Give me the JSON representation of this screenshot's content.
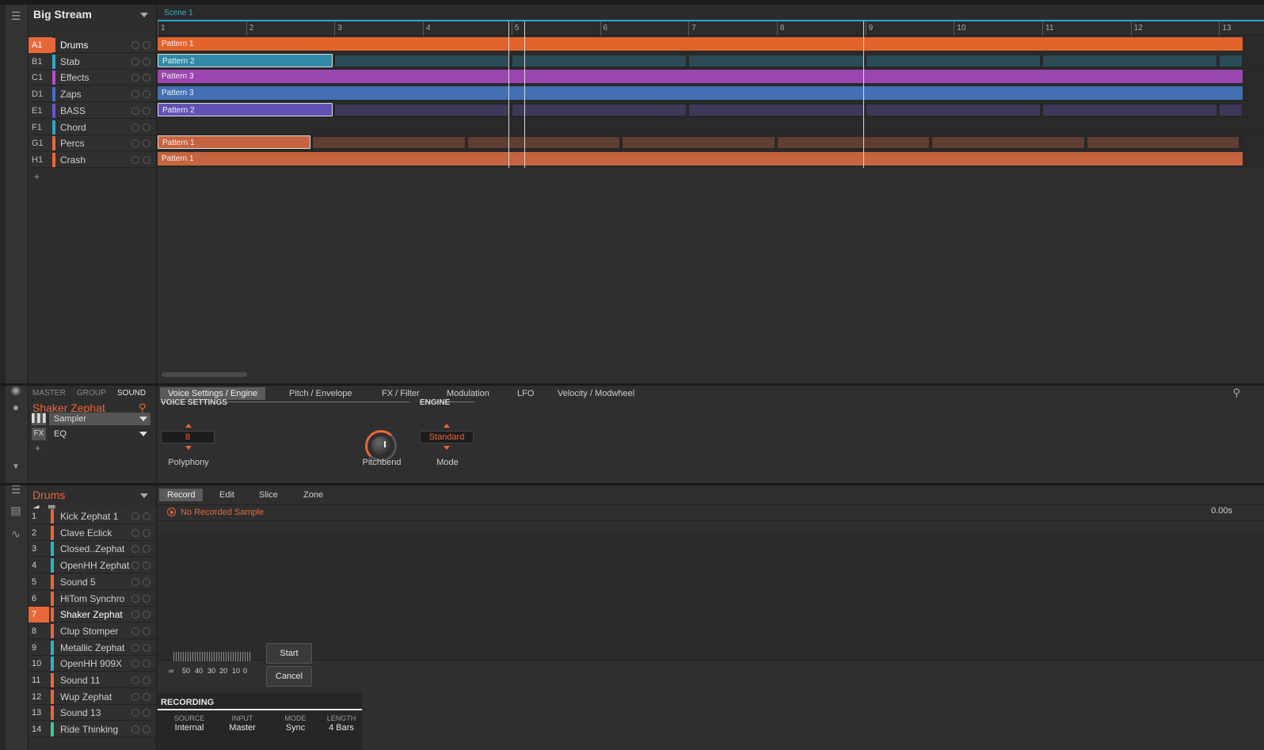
{
  "project": {
    "title": "Big Stream"
  },
  "scene": {
    "label": "Scene 1"
  },
  "ruler": [
    "1",
    "2",
    "3",
    "4",
    "5",
    "6",
    "7",
    "8",
    "9",
    "10",
    "11",
    "12",
    "13"
  ],
  "groups": [
    {
      "slot": "A1",
      "name": "Drums",
      "color": "#e8683a",
      "selected": true
    },
    {
      "slot": "B1",
      "name": "Stab",
      "color": "#2aa7c9"
    },
    {
      "slot": "C1",
      "name": "Effects",
      "color": "#b04fc4"
    },
    {
      "slot": "D1",
      "name": "Zaps",
      "color": "#3f73c9"
    },
    {
      "slot": "E1",
      "name": "BASS",
      "color": "#6b56c9"
    },
    {
      "slot": "F1",
      "name": "Chord",
      "color": "#2aa7c9"
    },
    {
      "slot": "G1",
      "name": "Percs",
      "color": "#e8683a"
    },
    {
      "slot": "H1",
      "name": "Crash",
      "color": "#e8683a"
    }
  ],
  "clips": [
    {
      "label": "Pattern 1",
      "color": "#e2642d"
    },
    {
      "label": "Pattern 2",
      "color": "#2f8aa8"
    },
    {
      "label": "Pattern 3",
      "color": "#9a45b0"
    },
    {
      "label": "Pattern 3",
      "color": "#4370b5"
    },
    {
      "label": "Pattern 2",
      "color": "#6352b5"
    },
    {
      "label": "",
      "color": ""
    },
    {
      "label": "Pattern 1",
      "color": "#c6643f"
    },
    {
      "label": "Pattern 1",
      "color": "#c6643f"
    }
  ],
  "control": {
    "tabs": [
      "MASTER",
      "GROUP",
      "SOUND"
    ],
    "sound_name": "Shaker Zephat",
    "plugins": [
      {
        "icon": "▌▌▌",
        "name": "Sampler"
      },
      {
        "icon": "FX",
        "name": "EQ"
      }
    ],
    "page_tabs": [
      "Voice Settings / Engine",
      "Pitch / Envelope",
      "FX / Filter",
      "Modulation",
      "LFO",
      "Velocity / Modwheel"
    ],
    "voice_settings_label": "VOICE SETTINGS",
    "engine_label": "ENGINE",
    "polyphony_value": "8",
    "polyphony_label": "Polyphony",
    "pitchbend_label": "Pitchbend",
    "mode_value": "Standard",
    "mode_label": "Mode"
  },
  "sounds_panel": {
    "group_name": "Drums",
    "sounds": [
      {
        "num": "1",
        "name": "Kick Zephat 1",
        "color": "#e8683a"
      },
      {
        "num": "2",
        "name": "Clave Eclick",
        "color": "#e8683a"
      },
      {
        "num": "3",
        "name": "Closed..Zephat",
        "color": "#2ab3c9"
      },
      {
        "num": "4",
        "name": "OpenHH Zephat",
        "color": "#2ab3c9"
      },
      {
        "num": "5",
        "name": "Sound 5",
        "color": "#e8683a"
      },
      {
        "num": "6",
        "name": "HiTom Synchro",
        "color": "#e8683a"
      },
      {
        "num": "7",
        "name": "Shaker Zephat",
        "color": "#e8683a",
        "selected": true
      },
      {
        "num": "8",
        "name": "Clup Stomper",
        "color": "#e8683a"
      },
      {
        "num": "9",
        "name": "Metallic Zephat",
        "color": "#2ab3c9"
      },
      {
        "num": "10",
        "name": "OpenHH 909X",
        "color": "#2ab3c9"
      },
      {
        "num": "11",
        "name": "Sound 11",
        "color": "#e8683a"
      },
      {
        "num": "12",
        "name": "Wup Zephat",
        "color": "#e8683a"
      },
      {
        "num": "13",
        "name": "Sound 13",
        "color": "#e8683a"
      },
      {
        "num": "14",
        "name": "Ride Thinking",
        "color": "#3fc98a"
      }
    ]
  },
  "sampler": {
    "tabs": [
      "Record",
      "Edit",
      "Slice",
      "Zone"
    ],
    "status": "No Recorded Sample",
    "time": "0.00s",
    "meter_labels": [
      "∞",
      "50",
      "40",
      "30",
      "20",
      "10",
      "0"
    ],
    "start_label": "Start",
    "cancel_label": "Cancel",
    "recording_title": "RECORDING",
    "recording_fields": [
      {
        "head": "SOURCE",
        "value": "Internal"
      },
      {
        "head": "INPUT",
        "value": "Master"
      },
      {
        "head": "MODE",
        "value": "Sync"
      },
      {
        "head": "LENGTH",
        "value": "4 Bars"
      }
    ]
  }
}
